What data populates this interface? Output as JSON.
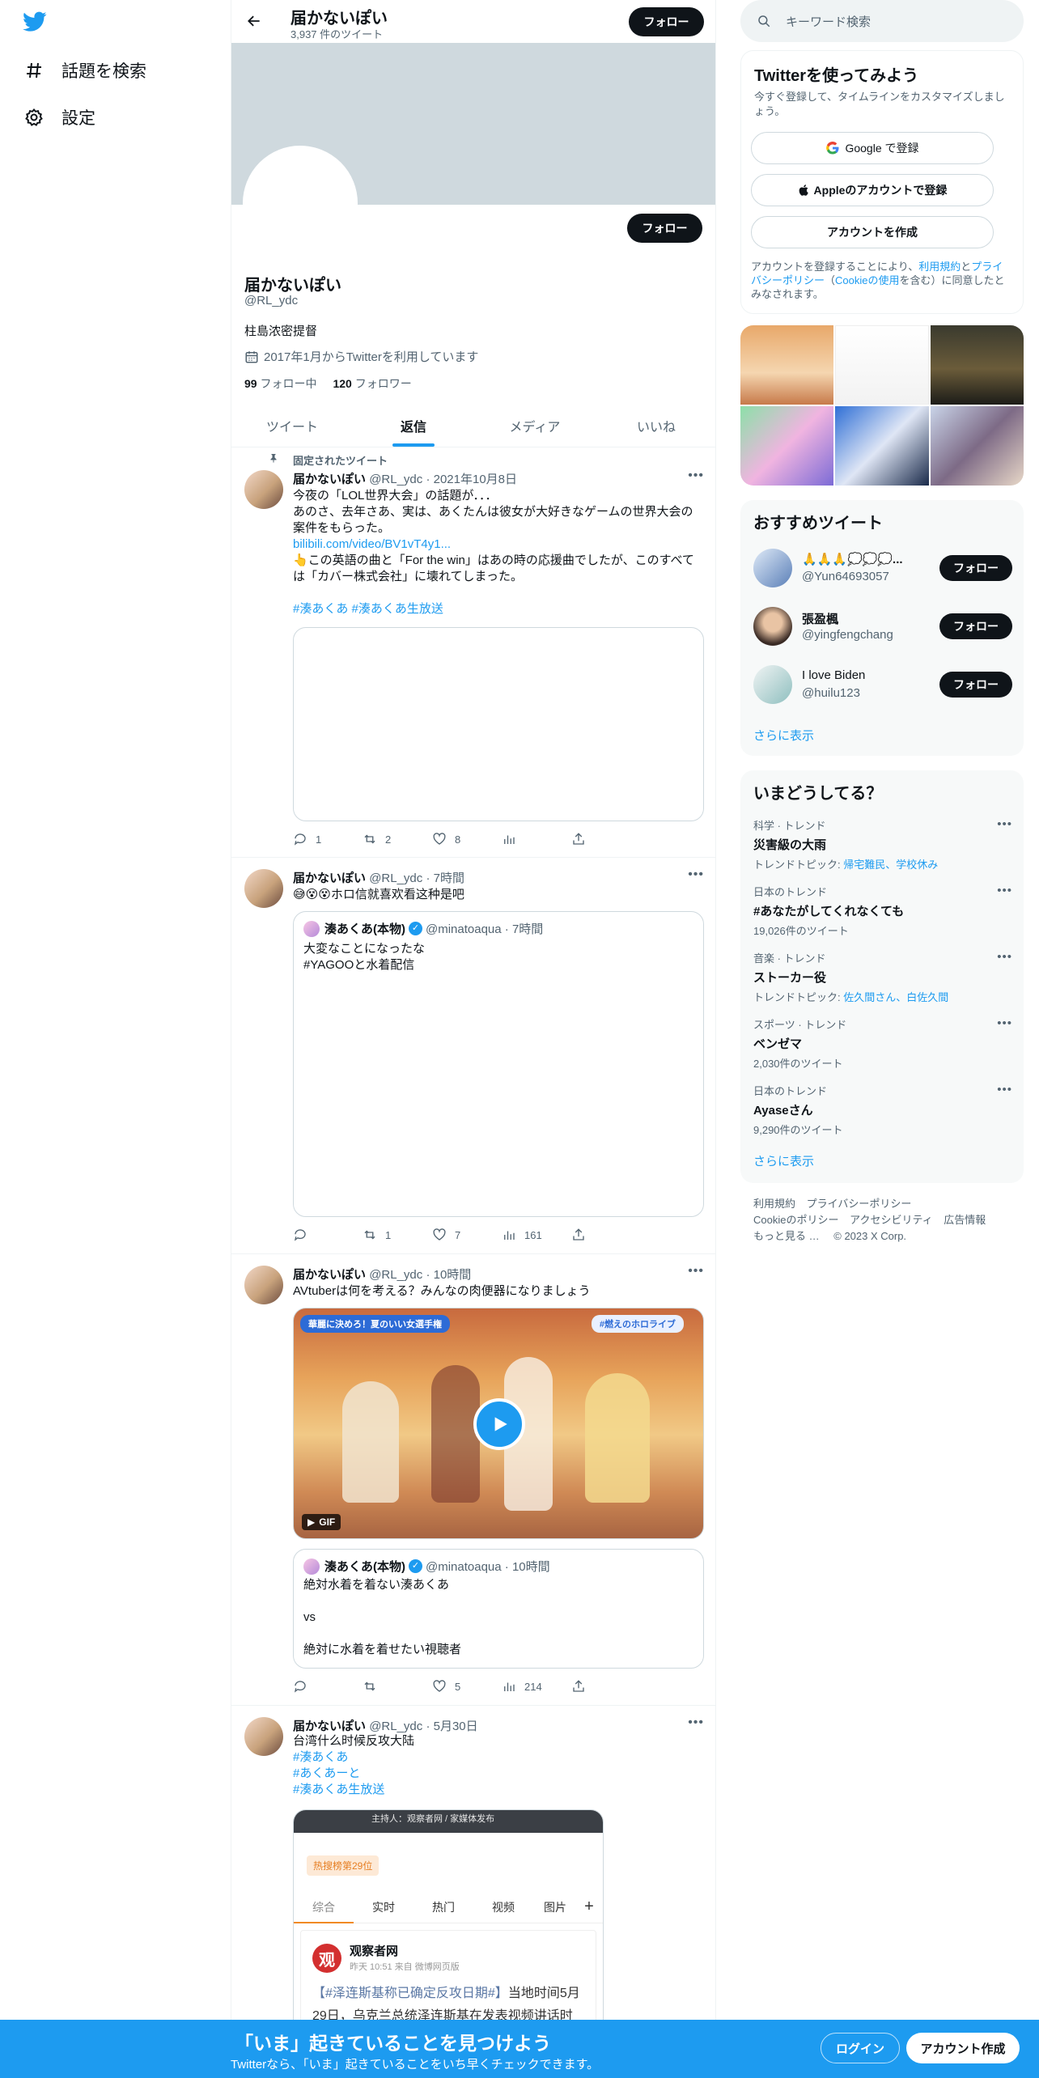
{
  "nav": {
    "explore_label": "話題を検索",
    "settings_label": "設定"
  },
  "header": {
    "name": "届かないぽい",
    "tweet_count": "3,937 件のツイート",
    "follow_label": "フォロー"
  },
  "profile": {
    "follow_label": "フォロー",
    "name": "届かないぽい",
    "handle": "@RL_ydc",
    "bio": "柱島浓密提督",
    "joined": "2017年1月からTwitterを利用しています",
    "following_count": "99",
    "following_label": "フォロー中",
    "followers_count": "120",
    "followers_label": "フォロワー"
  },
  "tabs": [
    "ツイート",
    "返信",
    "メディア",
    "いいね"
  ],
  "tweets": [
    {
      "pinned_label": "固定されたツイート",
      "name": "届かないぽい",
      "meta": "@RL_ydc · 2021年10月8日",
      "line1": "今夜の「LOL世界大会」の話題が．．．",
      "line2": "あのさ、去年さあ、実は、あくたんは彼女が大好きなゲームの世界大会の案件をもらった。",
      "link": "bilibili.com/video/BV1vT4y1...",
      "line3": "👆この英語の曲と「For the win」はあの時の応援曲でしたが、このすべては「カバー株式会社」に壊れてしまった。",
      "hashtags": "#湊あくあ #湊あくあ生放送",
      "reply_count": "1",
      "retweet_count": "2",
      "like_count": "8"
    },
    {
      "name": "届かないぽい",
      "meta": "@RL_ydc · 7時間",
      "text": "😅😵😵ホロ信就喜欢看这种是吧",
      "quote_name": "湊あくあ(本物)",
      "quote_meta": "@minatoaqua · 7時間",
      "quote_text": "大変なことになったな\n#YAGOOと水着配信",
      "retweet_count": "1",
      "like_count": "7",
      "view_count": "161"
    },
    {
      "name": "届かないぽい",
      "meta": "@RL_ydc · 10時間",
      "text": "AVtuberは何を考える？みんなの肉便器になりましょう",
      "video_banner_left": "華麗に決めろ！夏のいい女選手権",
      "video_banner_right": "#燃えのホロライブ",
      "gif_label": "GIF",
      "quote_name": "湊あくあ(本物)",
      "quote_meta": "@minatoaqua · 10時間",
      "quote_text": "絶対水着を着ない湊あくあ\n\nvs\n\n絶対に水着を着せたい視聴者",
      "like_count": "5",
      "view_count": "214"
    },
    {
      "name": "届かないぽい",
      "meta": "@RL_ydc · 5月30日",
      "text": "台湾什么时候反攻大陆",
      "hashtag1": "#湊あくあ",
      "hashtag2": "#あくあーと",
      "hashtag3": "#湊あくあ生放送",
      "shot": {
        "top_caption": "主持人：观察者网 / 家媒体发布",
        "hot_badge": "热搜榜第29位",
        "tabs": [
          "综合",
          "实时",
          "热门",
          "视频",
          "图片"
        ],
        "plus": "+",
        "account": "观察者网",
        "account_meta": "昨天 10:51  来自 微博网页版",
        "post_link": "【#泽连斯基称已确定反攻日期#】",
        "post_tail": "当地时间5月",
        "post_line2": "29日，乌克兰总统泽连斯基在发表视频讲话时"
      }
    }
  ],
  "right": {
    "search_placeholder": "キーワード検索",
    "signup": {
      "title": "Twitterを使ってみよう",
      "subtitle": "今すぐ登録して、タイムラインをカスタマイズしましょう。",
      "google_label": "Google で登録",
      "apple_label": "Appleのアカウントで登録",
      "create_label": "アカウントを作成",
      "terms_prefix": "アカウントを登録することにより、",
      "terms_link1": "利用規約",
      "terms_mid": "と",
      "terms_link2": "プライバシーポリシー",
      "terms_paren": "（",
      "terms_link3": "Cookieの使用",
      "terms_suffix": "を含む）に同意したとみなされます。"
    },
    "recommend": {
      "title": "おすすめツイート",
      "users": [
        {
          "name": "🙏🙏🙏💭💭💭...",
          "handle": "@Yun64693057",
          "button": "フォロー"
        },
        {
          "name": "張盈楓",
          "handle": "@yingfengchang",
          "button": "フォロー"
        },
        {
          "name": "I love Biden",
          "handle": "@huilu123",
          "button": "フォロー"
        }
      ],
      "more": "さらに表示"
    },
    "trends": {
      "title": "いまどうしてる？",
      "items": [
        {
          "category": "科学 · トレンド",
          "name": "災害級の大雨",
          "sub_prefix": "トレンドトピック: ",
          "sub_link": "帰宅難民、学校休み"
        },
        {
          "category": "日本のトレンド",
          "name": "#あなたがしてくれなくても",
          "sub_prefix": "19,026件のツイート",
          "sub_link": ""
        },
        {
          "category": "音楽 · トレンド",
          "name": "ストーカー役",
          "sub_prefix": "トレンドトピック: ",
          "sub_link": "佐久間さん、白佐久間"
        },
        {
          "category": "スポーツ · トレンド",
          "name": "ベンゼマ",
          "sub_prefix": "2,030件のツイート",
          "sub_link": ""
        },
        {
          "category": "日本のトレンド",
          "name": "Ayaseさん",
          "sub_prefix": "9,290件のツイート",
          "sub_link": ""
        }
      ],
      "more": "さらに表示"
    },
    "footer": {
      "line1": [
        "利用規約",
        "プライバシーポリシー"
      ],
      "line2": [
        "Cookieのポリシー",
        "アクセシビリティ",
        "広告情報"
      ],
      "more": "もっと見る …",
      "copyright": "© 2023 X Corp."
    }
  },
  "bottom": {
    "title": "「いま」起きていることを見つけよう",
    "subtitle": "Twitterなら、「いま」起きていることをいち早くチェックできます。",
    "login_label": "ログイン",
    "signup_label": "アカウント作成"
  },
  "colors": {
    "accent": "#1d9bf0",
    "text": "#0f1419",
    "muted": "#536471",
    "banner": "#cfd9de"
  }
}
